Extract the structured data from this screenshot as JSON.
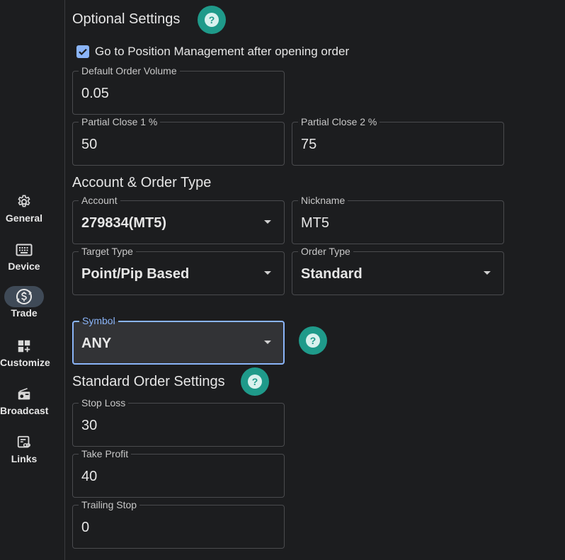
{
  "sidebar": {
    "items": [
      {
        "label": "General",
        "icon": "gear-icon"
      },
      {
        "label": "Device",
        "icon": "keyboard-icon"
      },
      {
        "label": "Trade",
        "icon": "trade-exchange-icon",
        "active": true
      },
      {
        "label": "Customize",
        "icon": "widgets-add-icon"
      },
      {
        "label": "Broadcast",
        "icon": "radio-icon"
      },
      {
        "label": "Links",
        "icon": "link-list-icon"
      }
    ]
  },
  "optional": {
    "title": "Optional Settings",
    "checkbox_label": "Go to Position Management after opening order",
    "checkbox_checked": true,
    "default_volume": {
      "label": "Default Order Volume",
      "value": "0.05"
    },
    "partial1": {
      "label": "Partial Close 1 %",
      "value": "50"
    },
    "partial2": {
      "label": "Partial Close 2 %",
      "value": "75"
    }
  },
  "account": {
    "title": "Account & Order Type",
    "account": {
      "label": "Account",
      "value": "279834(MT5)"
    },
    "nickname": {
      "label": "Nickname",
      "value": "MT5"
    },
    "target_type": {
      "label": "Target Type",
      "value": "Point/Pip Based"
    },
    "order_type": {
      "label": "Order Type",
      "value": "Standard"
    },
    "symbol": {
      "label": "Symbol",
      "value": "ANY"
    }
  },
  "standard": {
    "title": "Standard Order Settings",
    "stop_loss": {
      "label": "Stop Loss",
      "value": "30"
    },
    "take_profit": {
      "label": "Take Profit",
      "value": "40"
    },
    "trailing_stop": {
      "label": "Trailing Stop",
      "value": "0"
    }
  },
  "colors": {
    "background": "#1c1d1f",
    "accent_teal": "#1f9a8a",
    "focus_blue": "#8ab4f8",
    "active_nav": "#3f4a57"
  }
}
